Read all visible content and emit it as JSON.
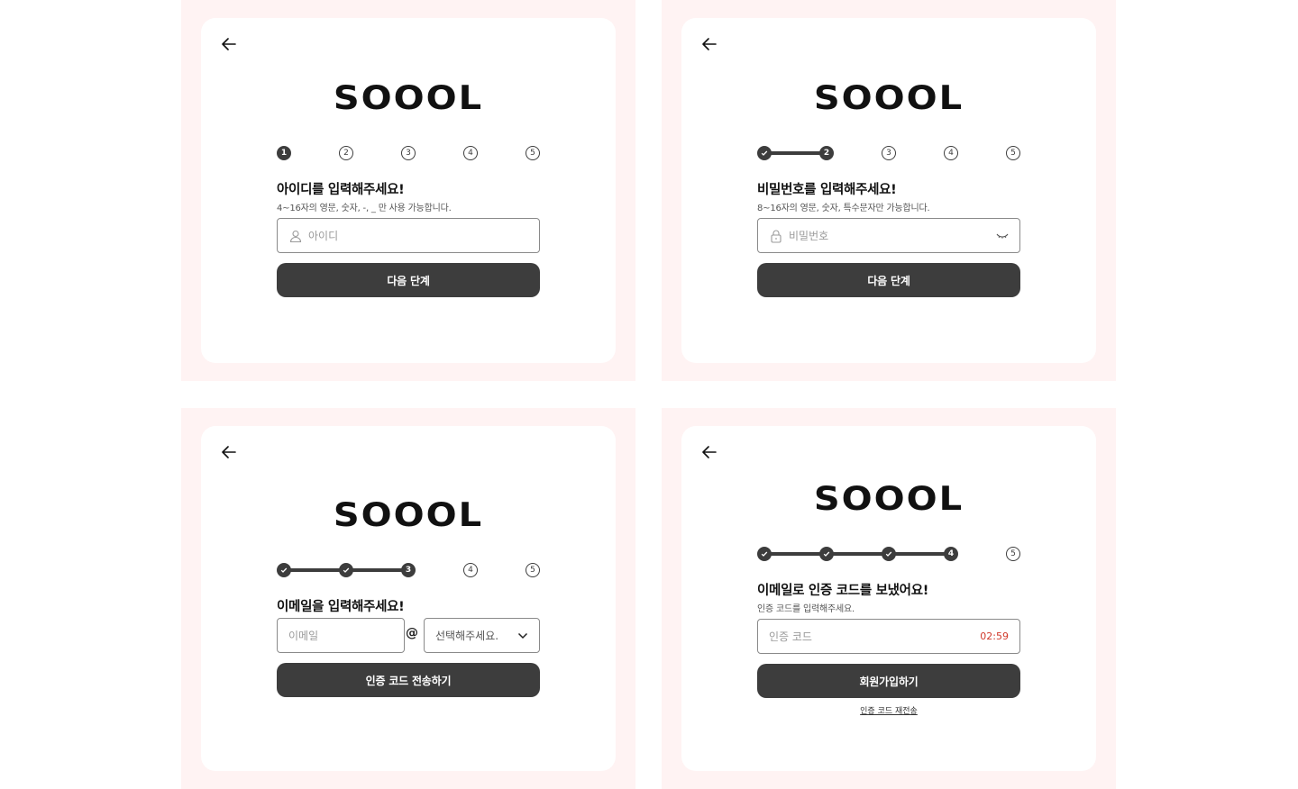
{
  "brand": "SOOOL",
  "back_icon": "arrow-left-icon",
  "screens": {
    "id": {
      "steps": [
        "1",
        "2",
        "3",
        "4",
        "5"
      ],
      "title": "아이디를 입력해주세요!",
      "subtitle": "4~16자의 영문, 숫자, -, _ 만 사용 가능합니다.",
      "input_placeholder": "아이디",
      "input_icon": "user-icon",
      "button": "다음 단계"
    },
    "password": {
      "steps": [
        "",
        "2",
        "3",
        "4",
        "5"
      ],
      "title": "비밀번호를 입력해주세요!",
      "subtitle": "8~16자의 영문, 숫자, 특수문자만 가능합니다.",
      "input_placeholder": "비밀번호",
      "input_icon": "lock-icon",
      "toggle_icon": "eye-closed-icon",
      "button": "다음 단계"
    },
    "email": {
      "steps": [
        "",
        "",
        "3",
        "4",
        "5"
      ],
      "title": "이메일을 입력해주세요!",
      "email_placeholder": "이메일",
      "at_sign": "@",
      "domain_select": "선택해주세요.",
      "button": "인증 코드 전송하기"
    },
    "verify": {
      "steps": [
        "",
        "",
        "",
        "4",
        "5"
      ],
      "title": "이메일로 인증 코드를 보냈어요!",
      "subtitle": "인증 코드를 입력해주세요.",
      "code_placeholder": "인증 코드",
      "timer": "02:59",
      "button": "회원가입하기",
      "resend_link": "인증 코드 재전송"
    }
  },
  "colors": {
    "panel_bg": "#fff3f3",
    "button_bg": "#3d3d3d",
    "timer": "#d0392b"
  }
}
